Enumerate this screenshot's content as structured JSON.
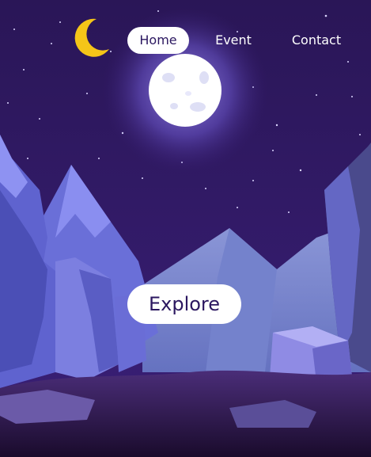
{
  "nav": {
    "logo_icon": "crescent-moon-icon",
    "items": [
      {
        "label": "Home",
        "active": true
      },
      {
        "label": "Event",
        "active": false
      },
      {
        "label": "Contact",
        "active": false
      }
    ]
  },
  "hero": {
    "cta_label": "Explore",
    "decor_icon": "full-moon-icon"
  },
  "colors": {
    "sky": "#2b1760",
    "moon_glow": "#8c7cf0",
    "moon": "#ffffff",
    "crescent": "#f5c518",
    "mountain_light": "#8a86e0",
    "mountain_dark": "#5a55c8",
    "ground": "#231036"
  }
}
